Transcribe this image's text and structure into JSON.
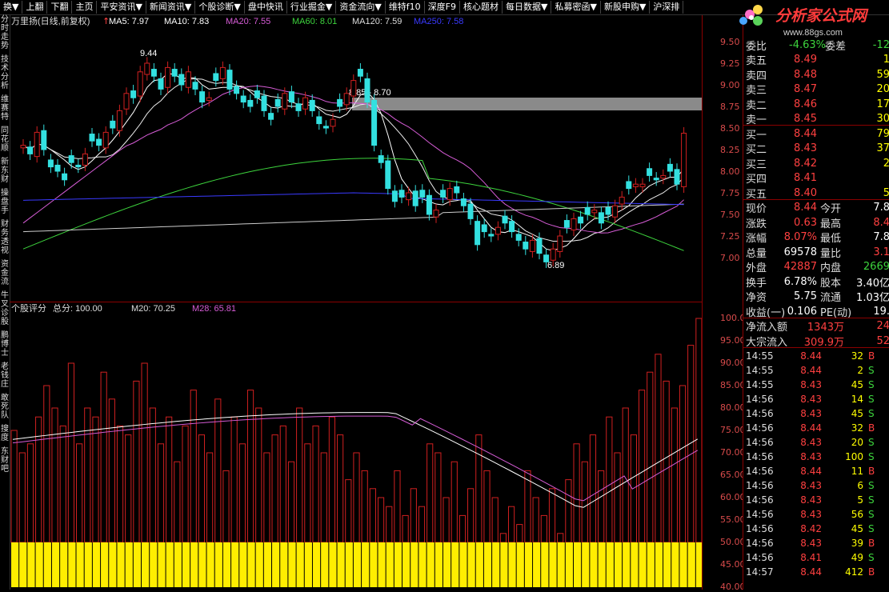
{
  "toolbar": {
    "items": [
      "换▼",
      "上翻",
      "下翻",
      "主页",
      "平安资讯▼",
      "新闻资讯▼",
      "个股诊断▼",
      "盘中快讯",
      "行业掘金▼",
      "资金流向▼",
      "维特f10",
      "深度F9",
      "核心题材",
      "每日数据▼",
      "私募密函▼",
      "新股申购▼",
      "沪深排"
    ]
  },
  "left_vtabs": [
    "分时走势",
    "技术分析",
    "维赛特",
    "同花顺",
    "新东财",
    "操盘手",
    "财务透视",
    "资金流",
    "牛叉诊股",
    "鹏博士",
    "老钱庄",
    "敢死队",
    "搜度",
    "东财吧"
  ],
  "main_chart": {
    "stock_title": "万里扬(日线,前复权)",
    "ma_labels": [
      {
        "text": "MA5: 7.97",
        "color": "#ffffff"
      },
      {
        "text": "MA10: 7.83",
        "color": "#ffffff"
      },
      {
        "text": "MA20: 7.55",
        "color": "#d65cd6"
      },
      {
        "text": "MA60: 8.01",
        "color": "#3dd43d"
      },
      {
        "text": "MA120: 7.59",
        "color": "#dddddd"
      },
      {
        "text": "MA250: 7.58",
        "color": "#3a3aff"
      }
    ],
    "annot_high": "9.44",
    "annot_low": "6.89",
    "annot_band": "8.85 - 8.70",
    "colors": {
      "up": "#d02020",
      "down": "#33e0e0",
      "ma5": "#ffffff",
      "ma20": "#d65cd6",
      "ma60": "#3dd43d",
      "ma120": "#cccccc",
      "ma250": "#3a3aff"
    },
    "price_axis": [
      "9.50",
      "9.25",
      "9.00",
      "8.75",
      "8.50",
      "8.25",
      "8.00",
      "7.75",
      "7.50",
      "7.25",
      "7.00"
    ]
  },
  "sub_chart": {
    "title": "个股评分",
    "total": "总分: 100.00",
    "m20": "M20: 70.25",
    "m28": "M28: 65.81",
    "score_axis": [
      "100.0",
      "95.00",
      "90.00",
      "85.00",
      "80.00",
      "75.00",
      "70.00",
      "65.00",
      "60.00",
      "55.00",
      "50.00",
      "45.00",
      "40.00"
    ]
  },
  "quote": {
    "header_row": {
      "label": "委比",
      "value": "-4.63%",
      "label2": "委差",
      "value2": "-12"
    },
    "asks": [
      {
        "label": "卖五",
        "price": "8.49",
        "vol": "1"
      },
      {
        "label": "卖四",
        "price": "8.48",
        "vol": "59"
      },
      {
        "label": "卖三",
        "price": "8.47",
        "vol": "20"
      },
      {
        "label": "卖二",
        "price": "8.46",
        "vol": "17"
      },
      {
        "label": "卖一",
        "price": "8.45",
        "vol": "30"
      }
    ],
    "bids": [
      {
        "label": "买一",
        "price": "8.44",
        "vol": "79"
      },
      {
        "label": "买二",
        "price": "8.43",
        "vol": "37"
      },
      {
        "label": "买三",
        "price": "8.42",
        "vol": "2"
      },
      {
        "label": "买四",
        "price": "8.41",
        "vol": ""
      },
      {
        "label": "买五",
        "price": "8.40",
        "vol": "5"
      }
    ],
    "stats": [
      {
        "l1": "现价",
        "v1": "8.44",
        "l2": "今开",
        "v2": "7.8"
      },
      {
        "l1": "涨跌",
        "v1": "0.63",
        "l2": "最高",
        "v2": "8.4"
      },
      {
        "l1": "涨幅",
        "v1": "8.07%",
        "l2": "最低",
        "v2": "7.8"
      },
      {
        "l1": "总量",
        "v1": "69578",
        "l2": "量比",
        "v2": "3.1"
      },
      {
        "l1": "外盘",
        "v1": "42887",
        "l2": "内盘",
        "v2": "2669"
      },
      {
        "l1": "换手",
        "v1": "6.78%",
        "l2": "股本",
        "v2": "3.40亿"
      },
      {
        "l1": "净资",
        "v1": "5.75",
        "l2": "流通",
        "v2": "1.03亿"
      },
      {
        "l1": "收益(一)",
        "v1": "0.106",
        "l2": "PE(动)",
        "v2": "19."
      }
    ],
    "flow": [
      {
        "label": "净流入额",
        "value": "1343万",
        "extra": "24"
      },
      {
        "label": "大宗流入",
        "value": "309.9万",
        "extra": "52"
      }
    ],
    "ticks": [
      {
        "time": "14:55",
        "price": "8.44",
        "vol": "32",
        "side": "B"
      },
      {
        "time": "14:55",
        "price": "8.44",
        "vol": "2",
        "side": "S"
      },
      {
        "time": "14:55",
        "price": "8.43",
        "vol": "45",
        "side": "S"
      },
      {
        "time": "14:56",
        "price": "8.43",
        "vol": "14",
        "side": "S"
      },
      {
        "time": "14:56",
        "price": "8.43",
        "vol": "45",
        "side": "S"
      },
      {
        "time": "14:56",
        "price": "8.44",
        "vol": "32",
        "side": "B"
      },
      {
        "time": "14:56",
        "price": "8.43",
        "vol": "20",
        "side": "S"
      },
      {
        "time": "14:56",
        "price": "8.43",
        "vol": "100",
        "side": "S"
      },
      {
        "time": "14:56",
        "price": "8.44",
        "vol": "11",
        "side": "B"
      },
      {
        "time": "14:56",
        "price": "8.43",
        "vol": "6",
        "side": "S"
      },
      {
        "time": "14:56",
        "price": "8.43",
        "vol": "5",
        "side": "S"
      },
      {
        "time": "14:56",
        "price": "8.43",
        "vol": "56",
        "side": "S"
      },
      {
        "time": "14:56",
        "price": "8.42",
        "vol": "45",
        "side": "S"
      },
      {
        "time": "14:56",
        "price": "8.43",
        "vol": "39",
        "side": "B"
      },
      {
        "time": "14:56",
        "price": "8.41",
        "vol": "49",
        "side": "S"
      },
      {
        "time": "14:57",
        "price": "8.44",
        "vol": "412",
        "side": "B"
      }
    ]
  },
  "logo": {
    "text": "分析家公式网",
    "url_text": "www.88gs.com"
  }
}
